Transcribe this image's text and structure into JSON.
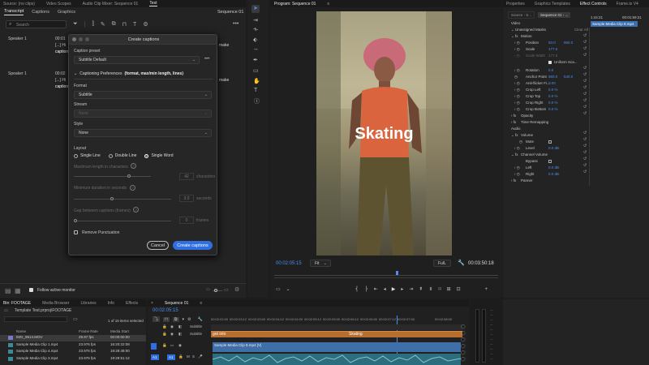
{
  "text_panel": {
    "tabs": [
      {
        "label": "Source: (no clips)"
      },
      {
        "label": "Video Scopes"
      },
      {
        "label": "Audio Clip Mixer: Sequence 01"
      },
      {
        "label": "Text"
      }
    ],
    "subtabs": [
      "Transcript",
      "Captions",
      "Graphics"
    ],
    "sequence_label": "Sequence 01",
    "search_placeholder": "Search",
    "speaker1": "Speaker 1",
    "speaker2": "Speaker 1",
    "ts1": "00:01",
    "ts2": "00:02",
    "snip1a": "[...] Hi",
    "snip1b": "caption",
    "snip2a": "[...] Hi",
    "snip2b": "caption",
    "make1": "make",
    "make2": "make",
    "follow_label": "Follow active monitor"
  },
  "dialog": {
    "title": "Create captions",
    "caption_preset_label": "Caption preset",
    "caption_preset_value": "Subtitle Default",
    "captioning_prefs_label": "Captioning Preferences",
    "captioning_prefs_detail": "(format, max/min length, lines)",
    "format_label": "Format",
    "format_value": "Subtitle",
    "stream_label": "Stream",
    "stream_value": "None",
    "style_label": "Style",
    "style_value": "None",
    "layout_label": "Layout",
    "layout_options": [
      "Single Line",
      "Double Line",
      "Single Word"
    ],
    "max_len_label": "Maximum length in characters",
    "max_len_value": "42",
    "max_len_unit": "characters",
    "min_dur_label": "Minimum duration in seconds",
    "min_dur_value": "3.0",
    "min_dur_unit": "seconds",
    "gap_label": "Gap between captions (frames)",
    "gap_value": "0",
    "gap_unit": "frames",
    "remove_punct": "Remove Punctuation",
    "cancel": "Cancel",
    "create": "Create captions"
  },
  "program": {
    "title": "Program: Sequence 01",
    "overlay_text": "Skating",
    "timecode": "00:02:05:15",
    "fit": "Fit",
    "quality": "Full",
    "duration": "00:03:50:18"
  },
  "top_right_tabs": [
    "Properties",
    "Graphics Templates",
    "Effect Controls",
    "Frame.io V4"
  ],
  "effect_controls": {
    "source_tab": "Source - S...",
    "seq_tab": "Sequence 01 - ...",
    "timecode": "1:44:21",
    "timecode2": "00:01:59:21",
    "clip_name": "Sample Media Clip 8.mp4",
    "video_label": "Video",
    "unassigned": "Unassigned Masks",
    "clear_all": "Clear All",
    "motion": "Motion",
    "position": "Position",
    "position_x": "50.0",
    "position_y": "960.0",
    "scale": "Scale",
    "scale_value": "177.6",
    "scale_width": "Scale Width",
    "scale_width_value": "177.6",
    "uniform": "Uniform Sca...",
    "rotation": "Rotation",
    "rotation_value": "0.0",
    "anchor": "Anchor Point",
    "anchor_x": "960.0",
    "anchor_y": "540.0",
    "antiflicker": "Anti-flicker Fi...",
    "antiflicker_value": "0.00",
    "crop_left": "Crop Left",
    "crop_left_value": "0.0 %",
    "crop_top": "Crop Top",
    "crop_top_value": "0.0 %",
    "crop_right": "Crop Right",
    "crop_right_value": "0.0 %",
    "crop_bottom": "Crop Bottom",
    "crop_bottom_value": "0.0 %",
    "opacity": "Opacity",
    "time_remap": "Time Remapping",
    "audio_label": "Audio",
    "volume": "Volume",
    "mute": "Mute",
    "level": "Level",
    "level_value": "0.0 dB",
    "channel_volume": "Channel Volume",
    "bypass": "Bypass",
    "left": "Left",
    "left_value": "0.0 dB",
    "right": "Right",
    "right_value": "0.0 dB",
    "panner": "Panner"
  },
  "bin": {
    "tabs": [
      "Bin: FOOTAGE",
      "Media Browser",
      "Libraries",
      "Info",
      "Effects"
    ],
    "path": "Template Test.prproj\\FOOTAGE",
    "selection": "1 of 16 items selected",
    "columns": [
      "Name",
      "Frame Rate",
      "Media Start"
    ],
    "rows": [
      {
        "name": "IMG_9614.MOV",
        "rate": "29.97 fps",
        "start": "00:00:00:00"
      },
      {
        "name": "Sample Media Clip 1.mp4",
        "rate": "23.976 fps",
        "start": "16:20:22:08"
      },
      {
        "name": "Sample Media Clip 4.mp4",
        "rate": "23.976 fps",
        "start": "19:28:48:00"
      },
      {
        "name": "Sample Media Clip 3.mp4",
        "rate": "23.976 fps",
        "start": "19:29:51:12"
      }
    ]
  },
  "timeline": {
    "tab": "Sequence 01",
    "timecode": "00:02:05:15",
    "ruler": [
      "00:02:02:00",
      "00:02:03:00",
      "00:02:04:00",
      "00:02:05:00",
      "00:02:06:00",
      "00:02:07:00",
      "00:02:08:00"
    ],
    "ruler_b": [
      "00:02:03:12",
      "00:02:04:12",
      "00:02:05:12",
      "00:02:06:12",
      "00:02:07:12"
    ],
    "track_sub1": "Subtitle",
    "track_sub2": "Subtitle",
    "caption_clip_1": "got into",
    "caption_clip_2": "Skating",
    "video_clip": "Sample Media Clip 8.mp4 [V]",
    "track_a1": "A1",
    "track_a1b": "A1"
  },
  "colors": {
    "accent": "#2f6fe0",
    "caption_clip": "#b86e2e",
    "video_clip": "#3f6fa8",
    "audio_clip": "#2c6e7e"
  }
}
